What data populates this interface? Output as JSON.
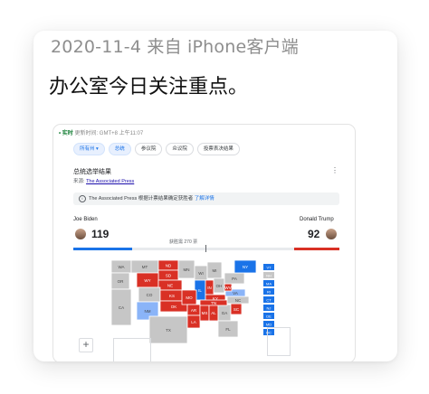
{
  "post": {
    "meta": "2020-11-4 来自 iPhone客户端",
    "text": "办公室今日关注重点。"
  },
  "screenshot": {
    "status": {
      "live": "• 实时",
      "updated": "更新时间: GMT+8 上午11:07"
    },
    "tabs": [
      "所有州 ▾",
      "总统",
      "参议院",
      "众议院",
      "投票表决结果"
    ],
    "selected_tab_index": 1,
    "results_title": "总统选举结果",
    "source_label": "来源:",
    "source_name": "The Associated Press",
    "notice_text": "The Associated Press 根据计票结果确定获胜者",
    "notice_more": "了解详情",
    "candidates": {
      "left": {
        "name": "Joe Biden",
        "votes": "119",
        "color": "#1a73e8"
      },
      "right": {
        "name": "Donald Trump",
        "votes": "92",
        "color": "#d93025"
      }
    },
    "needed_text": "获胜需 270 票",
    "bar": {
      "left_share": 0.22,
      "right_share": 0.17
    },
    "colors": {
      "dem": "#1a73e8",
      "dem_light": "#8ab4f8",
      "rep": "#d93025",
      "rep_light": "#f28b82",
      "undecided": "#c6c6c6"
    },
    "map_labels": {
      "WA": "WA",
      "OR": "OR",
      "CA": "CA",
      "MT": "MT",
      "ND": "ND",
      "SD": "SD",
      "WY": "WY",
      "NE": "NE",
      "CO": "CO",
      "KS": "KS",
      "OK": "OK",
      "NM": "NM",
      "TX": "TX",
      "MO": "MO",
      "AR": "AR",
      "LA": "LA",
      "MS": "MS",
      "AL": "AL",
      "GA": "GA",
      "FL": "FL",
      "NY": "NY",
      "PA": "PA",
      "IL": "IL",
      "WI": "WI",
      "MI": "MI",
      "IN": "IN",
      "OH": "OH",
      "KY": "KY",
      "TN": "TN",
      "SC": "SC",
      "NC": "NC",
      "VA": "VA",
      "WV": "WV",
      "MN": "MN"
    },
    "east_boxes": [
      "VT",
      "NH",
      "MA",
      "RI",
      "CT",
      "NJ",
      "DE",
      "MD",
      "DC"
    ],
    "zoom_in": "+"
  }
}
